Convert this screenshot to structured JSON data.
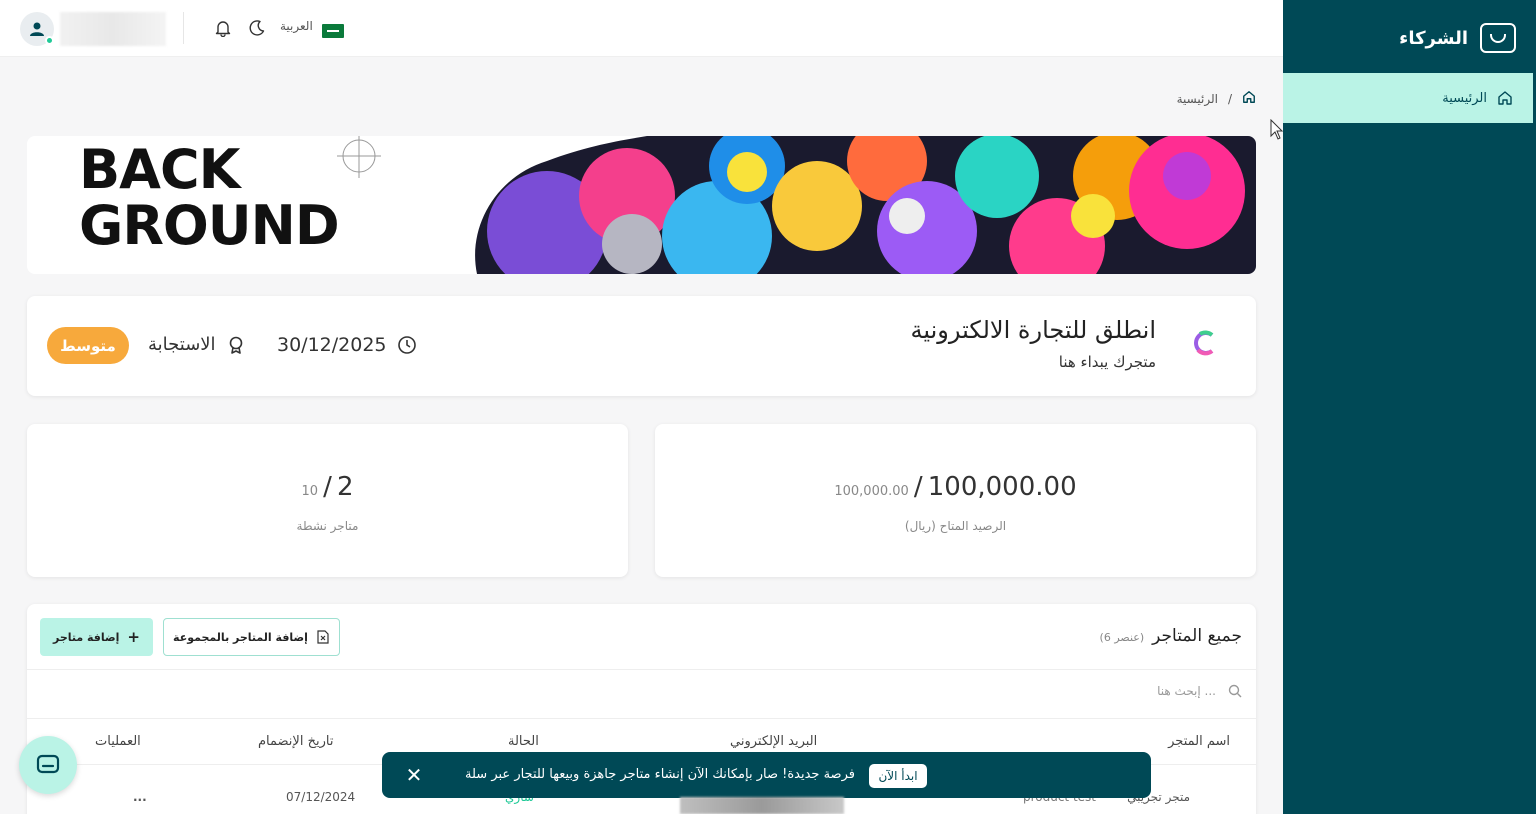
{
  "sidebar": {
    "brand_name": "الشركاء",
    "items": [
      {
        "label": "الرئيسية",
        "icon": "home-icon",
        "active": true
      }
    ]
  },
  "topbar": {
    "language": "العربية",
    "icons": [
      "bell-icon",
      "moon-icon"
    ]
  },
  "breadcrumb": {
    "current": "الرئيسية",
    "separator": "/"
  },
  "banner": {
    "line1": "BACK",
    "line2": "GROUND"
  },
  "store": {
    "title": "انطلق للتجارة الالكترونية",
    "subtitle": "متجرك يبداء هنا",
    "badge": "متوسط",
    "response_label": "الاستجابة",
    "date": "30/12/2025"
  },
  "stats": {
    "balance": {
      "value": "100,000.00",
      "sep": "/",
      "total": "100,000.00",
      "label": "الرصيد المتاح (ريال)"
    },
    "stores": {
      "value": "2",
      "sep": "/",
      "total": "10",
      "label": "متاجر نشطة"
    }
  },
  "table": {
    "title": "جميع المتاجر",
    "count": "(6 عنصر)",
    "add_button": "إضافة متاجر",
    "bulk_button": "إضافة المتاجر بالمجموعة",
    "search_placeholder": "إبحث هنا ...",
    "columns": [
      "اسم المتجر",
      "البريد الإلكتروني",
      "الحالة",
      "تاريخ الإنضمام",
      "العمليات"
    ],
    "rows": [
      {
        "name": "متجر تجريبي",
        "product": "product test",
        "status": "ساري",
        "joined": "07/12/2024",
        "actions": "..."
      }
    ]
  },
  "toast": {
    "message": "فرصة جديدة! صار بإمكانك الآن إنشاء متاجر جاهزة وبيعها للتجار عبر سلة",
    "action": "ابدأ الآن",
    "close": "✕"
  },
  "colors": {
    "primary": "#004956",
    "accent": "#baf3e6",
    "badge": "#f7a93c",
    "status": "#20c997"
  }
}
